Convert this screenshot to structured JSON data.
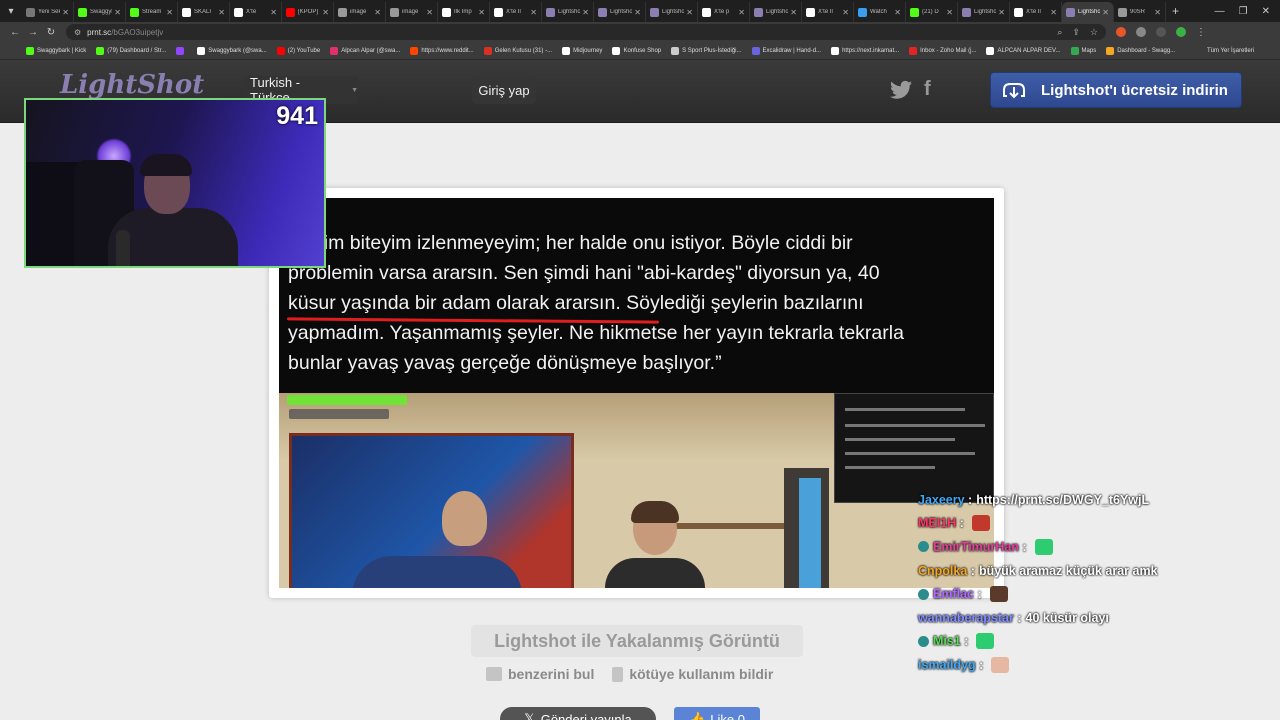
{
  "browser": {
    "tabs": [
      {
        "title": "Yeni Sekme",
        "fav": "#777777"
      },
      {
        "title": "Swaggybark",
        "fav": "#53fc18"
      },
      {
        "title": "Stream",
        "fav": "#53fc18"
      },
      {
        "title": "SKALI",
        "fav": "#ffffff"
      },
      {
        "title": "X'te",
        "fav": "#ffffff"
      },
      {
        "title": "[KPOP]",
        "fav": "#ff0000"
      },
      {
        "title": "image",
        "fav": "#999999"
      },
      {
        "title": "image",
        "fav": "#999999"
      },
      {
        "title": "İlk İmp",
        "fav": "#ffffff"
      },
      {
        "title": "X'te İl",
        "fav": "#ffffff"
      },
      {
        "title": "Lightshot",
        "fav": "#8a7fb0"
      },
      {
        "title": "Lightshot",
        "fav": "#8a7fb0"
      },
      {
        "title": "Lightshot",
        "fav": "#8a7fb0"
      },
      {
        "title": "X'te p",
        "fav": "#ffffff"
      },
      {
        "title": "Lightshot",
        "fav": "#8a7fb0"
      },
      {
        "title": "X'te İl",
        "fav": "#ffffff"
      },
      {
        "title": "Watch",
        "fav": "#3b9df0"
      },
      {
        "title": "(21) D",
        "fav": "#53fc18"
      },
      {
        "title": "Lightshot",
        "fav": "#8a7fb0"
      },
      {
        "title": "X'te İl",
        "fav": "#ffffff"
      },
      {
        "title": "Lightshot",
        "fav": "#8a7fb0",
        "active": true
      },
      {
        "title": "90SR",
        "fav": "#999999"
      }
    ],
    "url_host": "prnt.sc",
    "url_path": "/bGAO3uipetjv",
    "bookmarks": [
      {
        "label": "Swaggybark | Kick",
        "color": "#53fc18"
      },
      {
        "label": "(79) Dashboard / Str...",
        "color": "#53fc18"
      },
      {
        "label": "",
        "color": "#9146ff"
      },
      {
        "label": "Swaggybark (@swa...",
        "color": "#ffffff"
      },
      {
        "label": "(2) YouTube",
        "color": "#ff0000"
      },
      {
        "label": "Alpcan Alpar (@swa...",
        "color": "#e1306c"
      },
      {
        "label": "https://www.reddit...",
        "color": "#ff4500"
      },
      {
        "label": "Gelen Kutusu (31) -...",
        "color": "#d93025"
      },
      {
        "label": "Midjourney",
        "color": "#ffffff"
      },
      {
        "label": "Konfuse Shop",
        "color": "#ffffff"
      },
      {
        "label": "S Sport Plus-İstediği...",
        "color": "#cccccc"
      },
      {
        "label": "Excalidraw | Hand-d...",
        "color": "#6965db"
      },
      {
        "label": "https://next.inkamat...",
        "color": "#ffffff"
      },
      {
        "label": "Inbox - Zoho Mail (j...",
        "color": "#e42527"
      },
      {
        "label": "ALPCAN ALPAR DEV...",
        "color": "#ffffff"
      },
      {
        "label": "Maps",
        "color": "#34a853"
      },
      {
        "label": "Dashboard - Swagg...",
        "color": "#f5a623"
      }
    ],
    "bookmarks_all": "Tüm Yer İşaretleri"
  },
  "lightshot": {
    "logo": "LightShot",
    "language": "Turkish - Türkçe",
    "login": "Giriş yap",
    "download": "Lightshot'ı ücretsiz indirin",
    "screenshot_lines": [
      "öleyim biteyim izlenmeyeyim; her halde onu istiyor. Böyle ciddi bir",
      "problemin varsa ararsın. Sen şimdi hani \"abi-kardeş\" diyorsun ya, 40",
      "küsur yaşında bir adam olarak ararsın. Söylediği şeylerin bazılarını",
      "yapmadım. Yaşanmamış şeyler. Ne hikmetse her yayın tekrarla tekrarla",
      "bunlar yavaş yavaş gerçeğe dönüşmeye başlıyor.”"
    ],
    "caption": "Lightshot ile Yakalanmış Görüntü",
    "find_similar": "benzerini bul",
    "report_abuse": "kötüye kullanım bildir",
    "tweet": "Gönderi yayınla",
    "like": "Like 0"
  },
  "stream": {
    "viewer_count": "941",
    "chat": [
      {
        "user": "Jaxeery",
        "color": "#3fa9f5",
        "text": "https://prnt.sc/DWGY_t6YwjL",
        "emote": ""
      },
      {
        "user": "MEI1H",
        "color": "#ff3366",
        "text": "",
        "emote": "#c0392b"
      },
      {
        "user": "EmirTimurHan",
        "color": "#e0409a",
        "text": "",
        "emote": "#2ecc71",
        "badge": true
      },
      {
        "user": "Cnpolka",
        "color": "#f5a623",
        "text": "büyük aramaz küçük arar amk",
        "emote": ""
      },
      {
        "user": "Emflac",
        "color": "#b266ff",
        "text": "",
        "emote": "#5a3a2a",
        "badge": true
      },
      {
        "user": "wannaberapstar",
        "color": "#7f8cff",
        "text": "40 küsür olayı",
        "emote": ""
      },
      {
        "user": "Mis1",
        "color": "#57d957",
        "text": "",
        "emote": "#2ecc71",
        "badge": true
      },
      {
        "user": "ismaildyg",
        "color": "#3fa9f5",
        "text": "",
        "emote": "#e6b8a2"
      }
    ]
  },
  "colors": {
    "accent": "#2e4890",
    "webcam_border": "#7bd87b",
    "underline": "#e01e1e"
  }
}
